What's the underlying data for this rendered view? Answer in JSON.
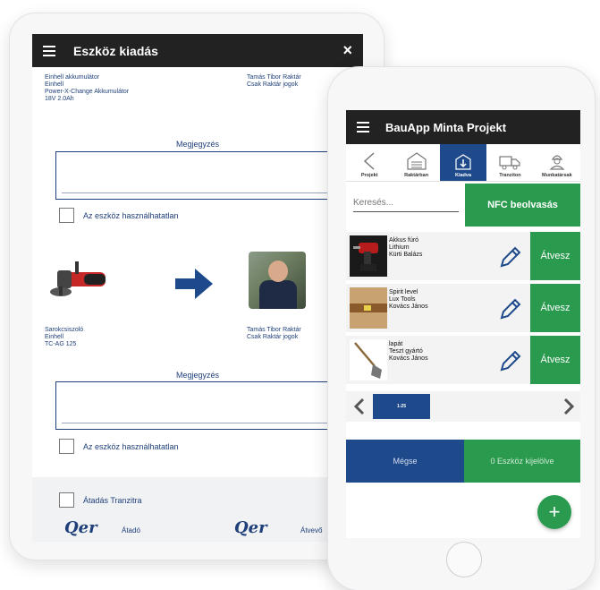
{
  "tablet": {
    "title": "Eszköz kiadás",
    "close_label": "×",
    "from_item": {
      "line1": "Einhell akkumulátor",
      "line2": "Einhell",
      "line3": "Power-X-Change Akkumulátor",
      "line4": "18V 2.0Ah"
    },
    "from_person": {
      "line1": "Tamás Tibor Raktár",
      "line2": "Csak Raktár jogok"
    },
    "note_label_1": "Megjegyzés",
    "unusable_1": "Az eszköz használhatatlan",
    "tool_item": {
      "line1": "Sarokcsiszoló",
      "line2": "Einhell",
      "line3": "TC-AG 125"
    },
    "to_person": {
      "line1": "Tamás Tibor Raktár",
      "line2": "Csak Raktár jogok"
    },
    "note_label_2": "Megjegyzés",
    "unusable_2": "Az eszköz használhatatlan",
    "transit_label": "Átadás Tranzitra",
    "giver_label": "Átadó",
    "receiver_label": "Átvevő",
    "sig_text": "Qer"
  },
  "phone": {
    "title": "BauApp Minta Projekt",
    "tabs": [
      {
        "label": "Projekt",
        "icon": "chevron-left-icon"
      },
      {
        "label": "Raktárban",
        "icon": "warehouse-icon"
      },
      {
        "label": "Kiadva",
        "icon": "handout-icon"
      },
      {
        "label": "Tranziton",
        "icon": "truck-icon"
      },
      {
        "label": "Munkatársak",
        "icon": "worker-icon"
      }
    ],
    "search_placeholder": "Keresés...",
    "nfc_label": "NFC beolvasás",
    "items": [
      {
        "line1": "Akkus fúró",
        "line2": "Lithium",
        "line3": "Kürti Balázs",
        "action": "Átvesz"
      },
      {
        "line1": "Spirit level",
        "line2": "Lux Tools",
        "line3": "Kovács János",
        "action": "Átvesz"
      },
      {
        "line1": "lapát",
        "line2": "Teszt gyártó",
        "line3": "Kovács János",
        "action": "Átvesz"
      }
    ],
    "page_label": "1-25",
    "cancel_label": "Mégse",
    "selected_label": "0 Eszköz kijelölve",
    "fab_label": "+"
  },
  "colors": {
    "header": "#222222",
    "primary_blue": "#1e4a8c",
    "green": "#2a9b4e",
    "text_blue": "#1e3f7a"
  }
}
